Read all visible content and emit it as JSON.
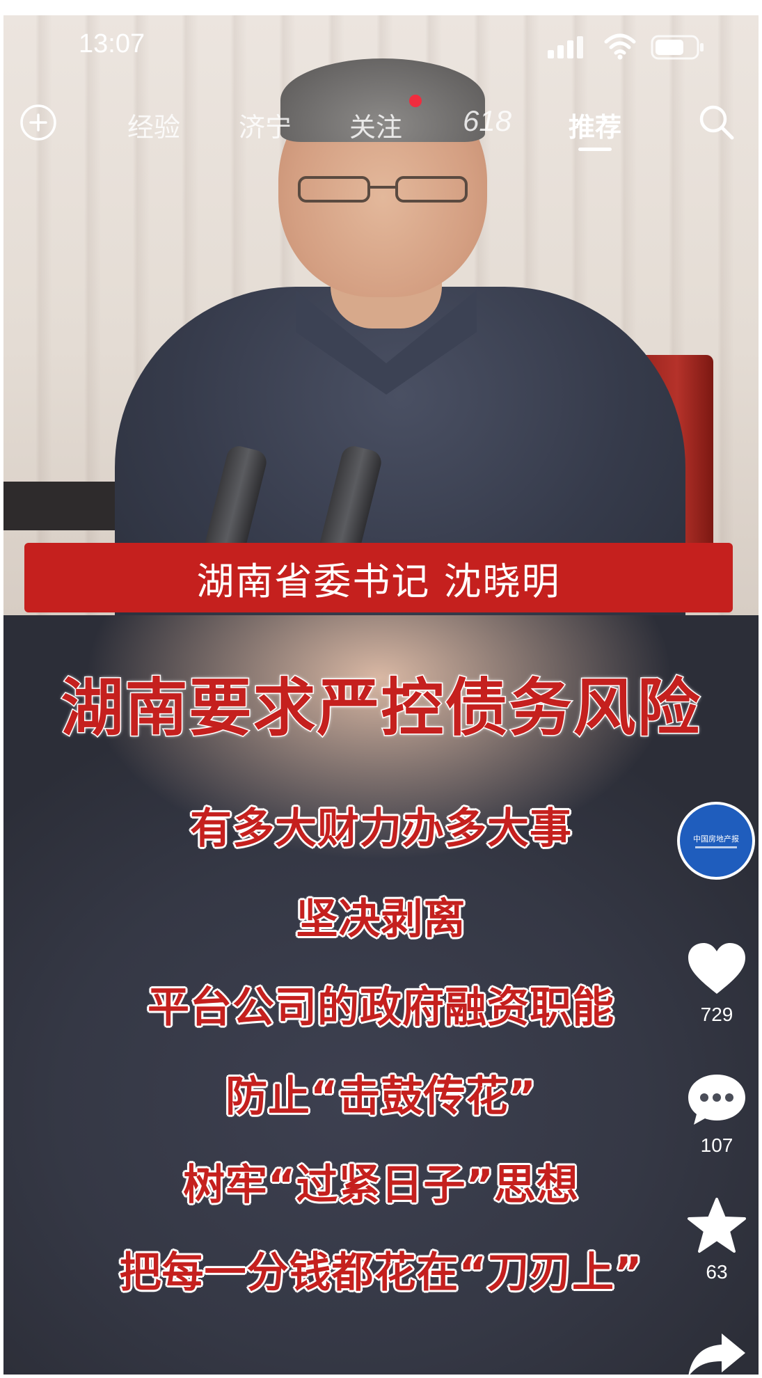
{
  "status_bar": {
    "time": "13:07"
  },
  "nav": {
    "tabs": [
      {
        "label": "经验"
      },
      {
        "label": "济宁"
      },
      {
        "label": "关注"
      },
      {
        "label": "618"
      },
      {
        "label": "推荐"
      }
    ],
    "active_tab": "推荐",
    "notification_dot_color": "#f02c3e"
  },
  "video": {
    "caption_banner": "湖南省委书记  沈晓明",
    "headline": "湖南要求严控债务风险",
    "lines": [
      "有多大财力办多大事",
      "坚决剥离",
      "平台公司的政府融资职能",
      "防止“击鼓传花”",
      "树牢“过紧日子”思想",
      "把每一分钱都花在“刀刃上”"
    ],
    "accent_color": "#c5201e"
  },
  "actions": {
    "avatar_text": "中国房地产报",
    "likes": "729",
    "comments": "107",
    "favorites": "63",
    "icons": [
      "heart-icon",
      "comment-icon",
      "star-icon",
      "share-icon"
    ]
  }
}
